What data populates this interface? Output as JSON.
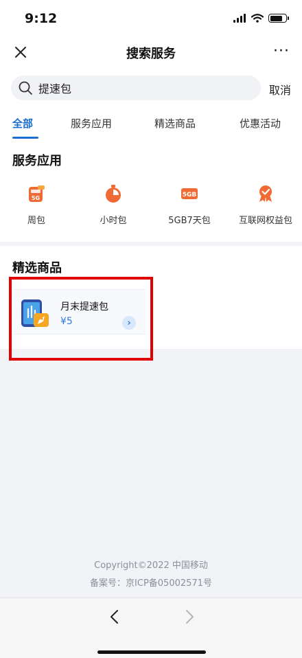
{
  "status_bar": {
    "time": "9:12",
    "icons": [
      "signal-icon",
      "wifi-icon",
      "battery-icon"
    ]
  },
  "header": {
    "title": "搜索服务",
    "close_icon": "close-icon",
    "more_label": "···"
  },
  "search": {
    "value": "提速包",
    "cancel_label": "取消"
  },
  "tabs": [
    {
      "label": "全部",
      "active": true
    },
    {
      "label": "服务应用",
      "active": false
    },
    {
      "label": "精选商品",
      "active": false
    },
    {
      "label": "优惠活动",
      "active": false
    }
  ],
  "services": {
    "title": "服务应用",
    "items": [
      {
        "label": "周包",
        "icon": "weekly-5g-icon",
        "icon_text": "5G"
      },
      {
        "label": "小时包",
        "icon": "timer-icon"
      },
      {
        "label": "5GB7天包",
        "icon": "data-5gb-icon",
        "icon_text": "5GB"
      },
      {
        "label": "互联网权益包",
        "icon": "medal-icon"
      }
    ]
  },
  "products": {
    "title": "精选商品",
    "items": [
      {
        "name": "月末提速包",
        "price": "¥5",
        "icon": "phone-rocket-icon"
      }
    ]
  },
  "footer": {
    "copyright": "Copyright©2022 中国移动",
    "icp": "备案号：京ICP备05002571号"
  },
  "bottom_nav": {
    "back_icon": "back-arrow-icon",
    "forward_icon": "forward-arrow-icon"
  },
  "colors": {
    "accent": "#1a6fd1",
    "price": "#2e7be0",
    "service_orange": "#f06a35",
    "highlight": "#e00000",
    "background": "#f1f3f6"
  }
}
